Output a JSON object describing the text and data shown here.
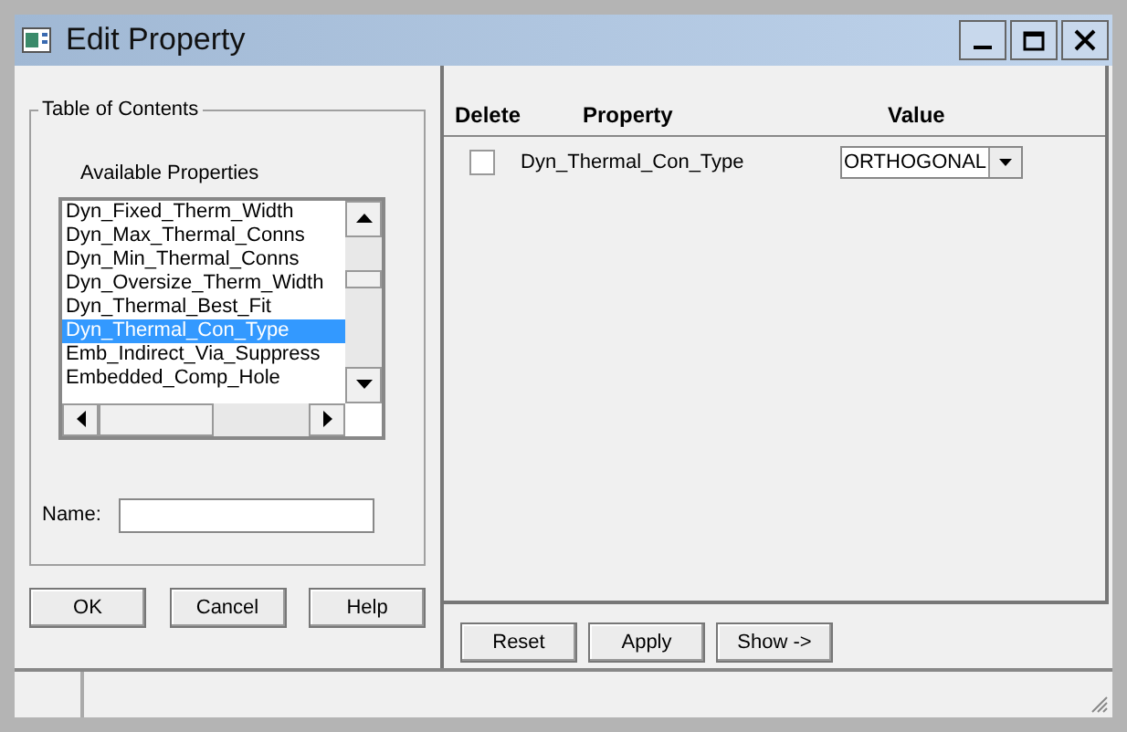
{
  "window": {
    "title": "Edit Property"
  },
  "table_of_contents": {
    "title": "Table of Contents",
    "list_label": "Available Properties",
    "items": [
      {
        "label": "Dyn_Fixed_Therm_Width",
        "selected": false
      },
      {
        "label": "Dyn_Max_Thermal_Conns",
        "selected": false
      },
      {
        "label": "Dyn_Min_Thermal_Conns",
        "selected": false
      },
      {
        "label": "Dyn_Oversize_Therm_Width",
        "selected": false
      },
      {
        "label": "Dyn_Thermal_Best_Fit",
        "selected": false
      },
      {
        "label": "Dyn_Thermal_Con_Type",
        "selected": true
      },
      {
        "label": "Emb_Indirect_Via_Suppress",
        "selected": false
      },
      {
        "label": "Embedded_Comp_Hole",
        "selected": false
      }
    ],
    "name_label": "Name:"
  },
  "left_buttons": [
    "OK",
    "Cancel",
    "Help"
  ],
  "property_table": {
    "columns": [
      "Delete",
      "Property",
      "Value"
    ],
    "rows": [
      {
        "delete": false,
        "property": "Dyn_Thermal_Con_Type",
        "value": "ORTHOGONAL"
      }
    ]
  },
  "right_buttons": [
    "Reset",
    "Apply",
    "Show ->"
  ]
}
